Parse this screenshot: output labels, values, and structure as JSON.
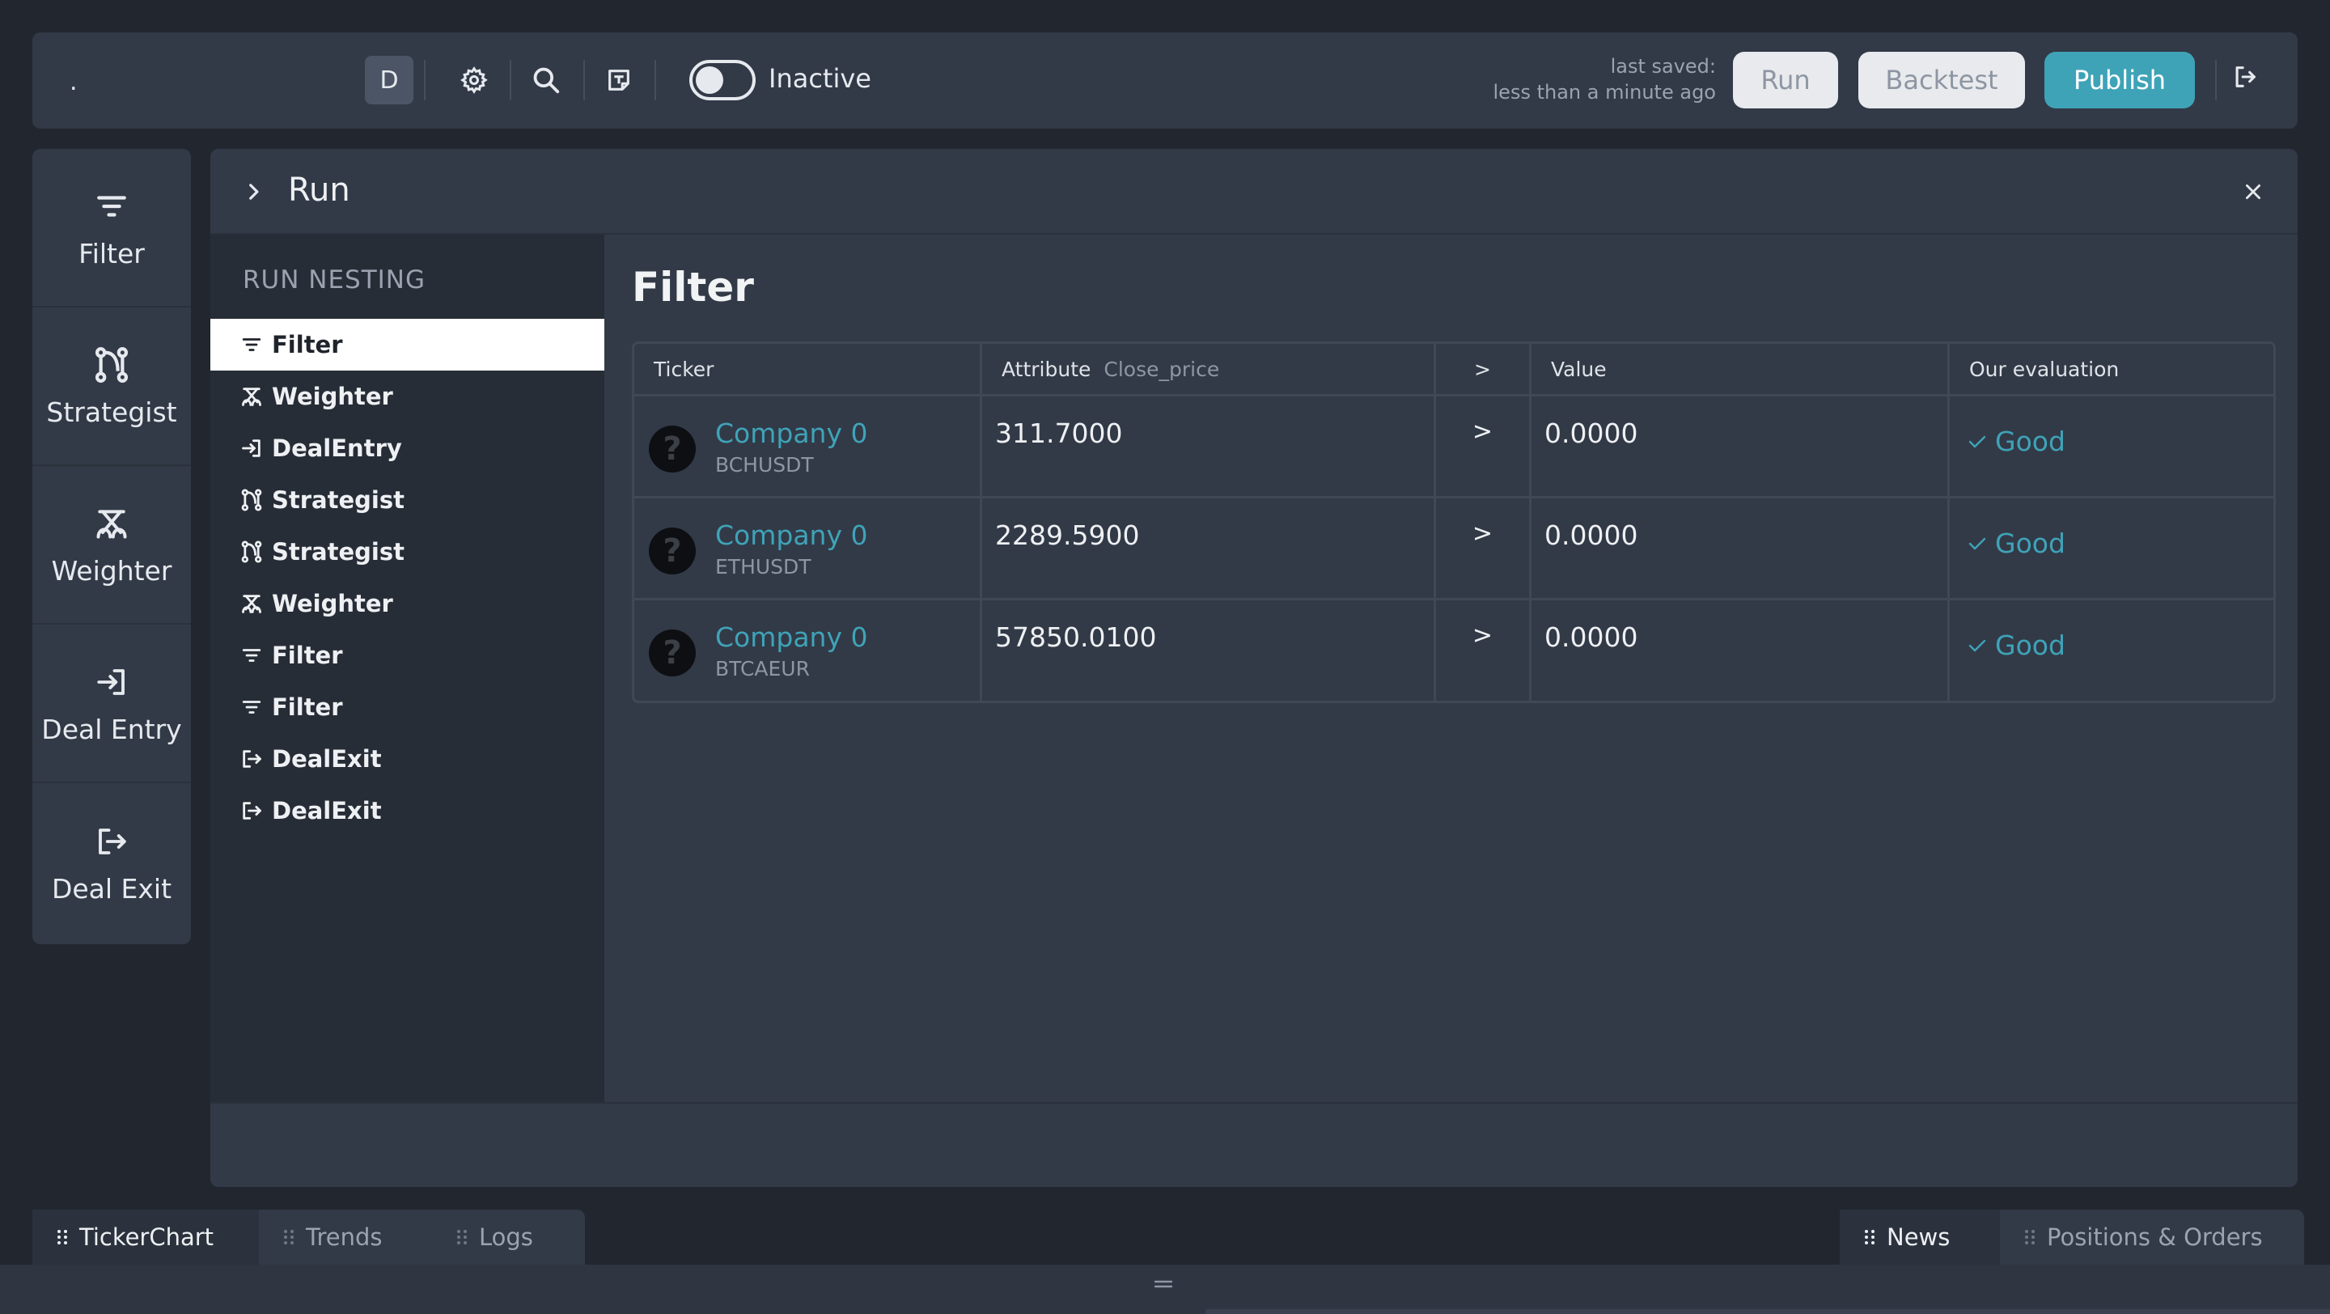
{
  "toolbar": {
    "app_mark": ".",
    "workspace_letter": "D",
    "status_label": "Inactive",
    "last_saved_label": "last saved:",
    "last_saved_value": "less than a minute ago",
    "run_label": "Run",
    "backtest_label": "Backtest",
    "publish_label": "Publish",
    "icons": [
      "gear-icon",
      "search-icon",
      "note-icon",
      "logout-icon"
    ]
  },
  "sidebar": {
    "items": [
      {
        "label": "Filter",
        "icon": "filter-icon"
      },
      {
        "label": "Strategist",
        "icon": "strategist-icon"
      },
      {
        "label": "Weighter",
        "icon": "weighter-icon"
      },
      {
        "label": "Deal Entry",
        "icon": "deal-entry-icon"
      },
      {
        "label": "Deal Exit",
        "icon": "deal-exit-icon"
      }
    ]
  },
  "panel": {
    "title": "Run",
    "nesting_title": "RUN NESTING",
    "nesting": [
      {
        "label": "Filter",
        "icon": "filter-icon",
        "active": true
      },
      {
        "label": "Weighter",
        "icon": "weighter-icon"
      },
      {
        "label": "DealEntry",
        "icon": "deal-entry-icon"
      },
      {
        "label": "Strategist",
        "icon": "strategist-icon"
      },
      {
        "label": "Strategist",
        "icon": "strategist-icon"
      },
      {
        "label": "Weighter",
        "icon": "weighter-icon"
      },
      {
        "label": "Filter",
        "icon": "filter-icon"
      },
      {
        "label": "Filter",
        "icon": "filter-icon"
      },
      {
        "label": "DealExit",
        "icon": "deal-exit-icon"
      },
      {
        "label": "DealExit",
        "icon": "deal-exit-icon"
      }
    ],
    "content_title": "Filter",
    "table": {
      "headers": {
        "ticker": "Ticker",
        "attribute": "Attribute",
        "attribute_name": "Close_price",
        "operator": ">",
        "value": "Value",
        "evaluation": "Our evaluation"
      },
      "rows": [
        {
          "company": "Company 0",
          "symbol": "BCHUSDT",
          "attribute": "311.7000",
          "operator": ">",
          "value": "0.0000",
          "evaluation": "Good"
        },
        {
          "company": "Company 0",
          "symbol": "ETHUSDT",
          "attribute": "2289.5900",
          "operator": ">",
          "value": "0.0000",
          "evaluation": "Good"
        },
        {
          "company": "Company 0",
          "symbol": "BTCAEUR",
          "attribute": "57850.0100",
          "operator": ">",
          "value": "0.0000",
          "evaluation": "Good"
        }
      ],
      "unknown_icon_glyph": "?"
    }
  },
  "bottom_tabs": {
    "left": [
      {
        "label": "TickerChart",
        "active": true
      },
      {
        "label": "Trends"
      },
      {
        "label": "Logs"
      }
    ],
    "right": [
      {
        "label": "News",
        "active": true
      },
      {
        "label": "Positions & Orders"
      }
    ]
  },
  "colors": {
    "background": "#22272f",
    "panel": "#323a47",
    "accent": "#3fa3b8",
    "nesting_bg": "#272d36"
  }
}
